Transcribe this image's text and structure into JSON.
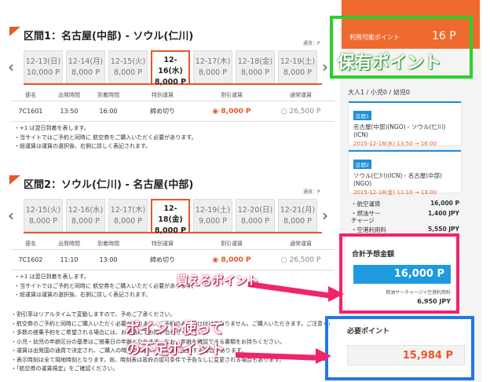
{
  "section1": {
    "title": "区間1：名古屋(中部) - ソウル(仁川)",
    "currency_note": "通貨：P",
    "dates": [
      {
        "date": "12-13(日)",
        "price": "10,000 P",
        "selected": false
      },
      {
        "date": "12-14(月)",
        "price": "8,000 P",
        "selected": false
      },
      {
        "date": "12-15(火)",
        "price": "8,000 P",
        "selected": false
      },
      {
        "date": "12-16(水)",
        "price": "8,000 P",
        "selected": true
      },
      {
        "date": "12-17(木)",
        "price": "8,000 P",
        "selected": false
      },
      {
        "date": "12-18(金)",
        "price": "8,000 P",
        "selected": false
      },
      {
        "date": "12-19(土)",
        "price": "8,000 P",
        "selected": false
      }
    ],
    "headers": [
      "便名",
      "出発時間",
      "到着時間",
      "特別運賃",
      "割引運賃",
      "通常運賃"
    ],
    "row": {
      "flight": "7C1601",
      "dep": "13:50",
      "arr": "16:00",
      "special": "締め切り",
      "discount": "8,000 P",
      "regular": "26,500 P"
    },
    "notes": [
      "・+1 は翌日到着を表します。",
      "・当サイトではご予約と同時に 航空券をご購入いただく必要があります。",
      "・総運賃は運賃の選択後、右側に詳しく表記されます。"
    ]
  },
  "section2": {
    "title": "区間2：ソウル(仁川) - 名古屋(中部)",
    "currency_note": "通貨：P",
    "dates": [
      {
        "date": "12-15(火)",
        "price": "8,000 P",
        "selected": false
      },
      {
        "date": "12-16(水)",
        "price": "8,000 P",
        "selected": false
      },
      {
        "date": "12-17(木)",
        "price": "8,000 P",
        "selected": false
      },
      {
        "date": "12-18(金)",
        "price": "8,000 P",
        "selected": true
      },
      {
        "date": "12-19(土)",
        "price": "9,000 P",
        "selected": false
      },
      {
        "date": "12-20(日)",
        "price": "8,000 P",
        "selected": false
      },
      {
        "date": "12-21(月)",
        "price": "8,000 P",
        "selected": false
      }
    ],
    "headers": [
      "便名",
      "出発時間",
      "到着時間",
      "特別運賃",
      "割引運賃",
      "通常運賃"
    ],
    "row": {
      "flight": "7C1602",
      "dep": "11:10",
      "arr": "13:00",
      "special": "締め切り",
      "discount": "8,000 P",
      "regular": "26,500 P"
    },
    "notes": [
      "・+1 は翌日到着を表します。",
      "・当サイトではご予約と同時に 航空券をご購入いただく必要があります。",
      "・総運賃は運賃の選択後、右側に詳しく表記されます。"
    ]
  },
  "bottom_notes": [
    "・割引率はリアルタイムで変動しますので、予めご了承ください。",
    "・航空券のご予約と同時にご購入いただく必要があります。ご予約のみは受け付けておりません。ご購入いただきます。ご注意ください。",
    "・多数の搭乗予約をご希望される場合には、お電話にてお問い合わせください。",
    "・小児・幼児の年齢区分の基準はご搭乗日の年齢となります。なお、年齢を確認できる書類をお持ちください。",
    "・運賃は出発国の通貨で決定され、ご購入の時点の為替レートにより変動する場合があります。",
    "・表示時刻は全て現地時刻となります。尚、時刻表は政府の認可条件で予告なしに変更される場合もあります。",
    "・「航空券の運賃規定」をご確認ください。"
  ],
  "sidebar": {
    "available_points_label": "利用可能ポイント",
    "available_points_value": "16 P",
    "pax": "大人1 / 小児0 / 幼児0",
    "seg1_label": "区間1",
    "seg1_route": "名古屋(中部)(NGO) - ソウル(仁川)(ICN)",
    "seg1_time": "2015-12-16(水) 13:50 → 16:00",
    "seg2_label": "区間2",
    "seg2_route": "ソウル(仁川)(ICN) - 名古屋(中部)(NGO)",
    "seg2_time": "2015-12-18(金) 11:10 → 13:00",
    "fare_rows": [
      {
        "label": "・航空運賃",
        "value": "16,000 P"
      },
      {
        "label": "・燃油サーチャージ",
        "value": "1,400 JPY"
      },
      {
        "label": "・空港利用料",
        "value": "5,550 JPY"
      }
    ],
    "total_label": "合計予想金額",
    "total_value": "16,000 P",
    "total_sub_label": "燃油サーチャージ+空港利用料",
    "total_sub_value": "6,950 JPY",
    "required_label": "必要ポイント",
    "required_value": "15,984 P"
  },
  "callouts": {
    "owned": "保有ポイント",
    "buyable": "買えるポイント",
    "shortage_line1": "ポイント使って",
    "shortage_line2": "の不足ポイント"
  },
  "colors": {
    "accent_orange": "#e8582a",
    "seg_blue": "#1e8fd8",
    "callout_green": "#2bd02b",
    "callout_pink": "#f0246b",
    "callout_blue": "#2277e8"
  }
}
